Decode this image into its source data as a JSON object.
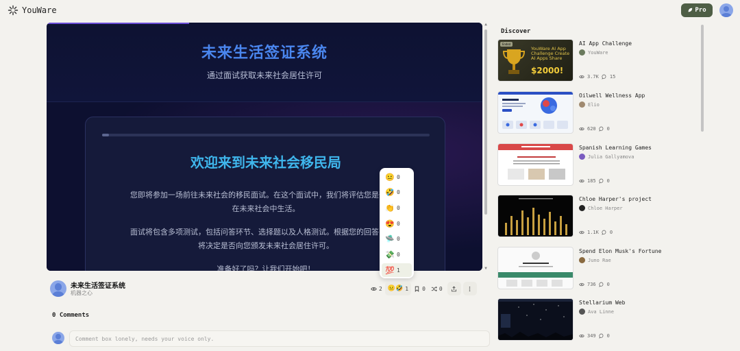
{
  "header": {
    "logo_text": "YouWare",
    "pro_label": "Pro"
  },
  "preview": {
    "title": "未来生活签证系统",
    "subtitle": "通过面试获取未来社会居住许可",
    "progress": 0.02,
    "card_title": "欢迎来到未来社会移民局",
    "paragraph_1": "您即将参加一场前往未来社会的移民面试。在这个面试中，我们将评估您是否适合在未来社会中生活。",
    "paragraph_2": "面试将包含多项测试，包括问答环节、选择题以及人格测试。根据您的回答，我们将决定是否向您颁发未来社会居住许可。",
    "paragraph_3": "准备好了吗？让我们开始吧！"
  },
  "reactions": [
    {
      "emoji": "😐",
      "count": "0"
    },
    {
      "emoji": "🤣",
      "count": "0"
    },
    {
      "emoji": "👏",
      "count": "0"
    },
    {
      "emoji": "😍",
      "count": "0"
    },
    {
      "emoji": "🛸",
      "count": "0"
    },
    {
      "emoji": "💸",
      "count": "0"
    },
    {
      "emoji": "💯",
      "count": "1"
    }
  ],
  "project": {
    "name": "未来生活签证系统",
    "author": "机器之心",
    "views": "2",
    "reaction_emojis": "😐🤣",
    "reaction_count": "1",
    "bookmarks": "0",
    "remixes": "0"
  },
  "comments": {
    "title": "0 Comments",
    "placeholder": "Comment box lonely, needs your voice only."
  },
  "discover": {
    "title": "Discover",
    "items": [
      {
        "title": "AI App Challenge",
        "author": "YouWare",
        "views": "3.7K",
        "comments": "15",
        "author_color": "#6b7b5e"
      },
      {
        "title": "Oilwell Wellness App",
        "author": "Elio",
        "views": "620",
        "comments": "0",
        "author_color": "#a08a70"
      },
      {
        "title": "Spanish Learning Games",
        "author": "Julia Gallyamova",
        "views": "185",
        "comments": "0",
        "author_color": "#7a5cc0"
      },
      {
        "title": "Chloe Harper's project",
        "author": "Chloe Harper",
        "views": "1.1K",
        "comments": "0",
        "author_color": "#222222"
      },
      {
        "title": "Spend Elon Musk's Fortune",
        "author": "Juno Rae",
        "views": "736",
        "comments": "0",
        "author_color": "#8a6a40"
      },
      {
        "title": "Stellarium Web",
        "author": "Ava Linne",
        "views": "349",
        "comments": "0",
        "author_color": "#555555"
      }
    ],
    "challenge_thumb": {
      "badge": "Ended",
      "text": "YouWare AI App Challenge Create AI Apps Share",
      "prize": "$2000!"
    }
  }
}
